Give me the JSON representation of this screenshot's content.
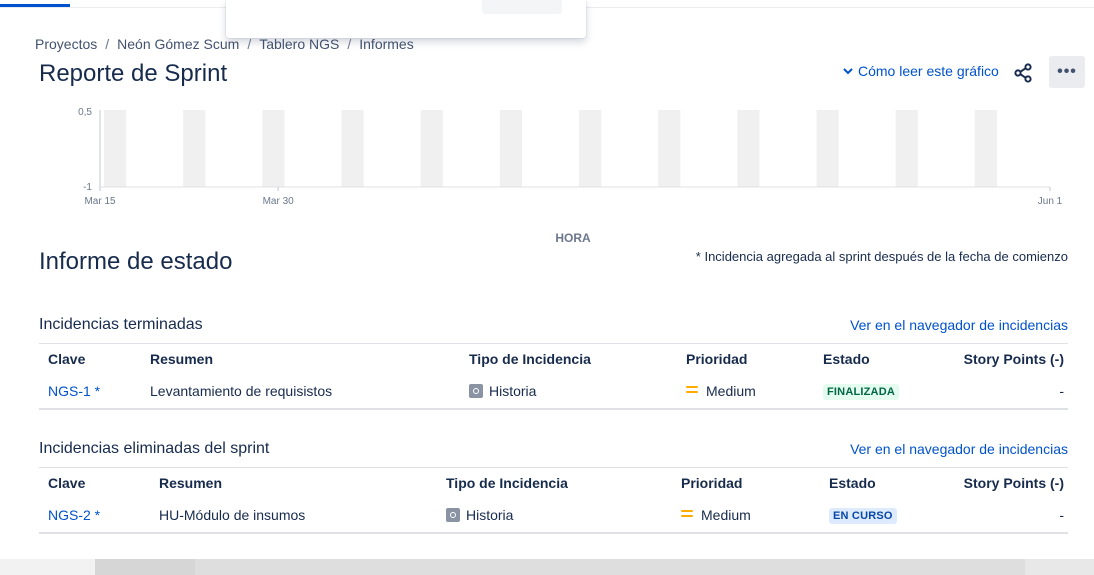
{
  "breadcrumb": [
    "Proyectos",
    "Neón Gómez Scum",
    "Tablero NGS",
    "Informes"
  ],
  "page_title": "Reporte de Sprint",
  "header_link": "Cómo leer este gráfico",
  "chart": {
    "y_top_label": "0,5",
    "y_bottom_label": "-1",
    "x_labels": [
      {
        "label": "Mar 15",
        "pos": 0
      },
      {
        "label": "Mar 30",
        "pos": 0.1875
      },
      {
        "label": "Jun 1",
        "pos": 1
      }
    ],
    "axis_title": "HORA"
  },
  "status_section": {
    "title": "Informe de estado",
    "note": "* Incidencia agregada al sprint después de la fecha de comienzo"
  },
  "completed": {
    "title": "Incidencias terminadas",
    "link": "Ver en el navegador de incidencias",
    "headers": [
      "Clave",
      "Resumen",
      "Tipo de Incidencia",
      "Prioridad",
      "Estado",
      "Story Points (-)"
    ],
    "rows": [
      {
        "key": "NGS-1 *",
        "summary": "Levantamiento de requisistos",
        "type": "Historia",
        "priority": "Medium",
        "status": "FINALIZADA",
        "points": "-"
      }
    ]
  },
  "removed": {
    "title": "Incidencias eliminadas del sprint",
    "link": "Ver en el navegador de incidencias",
    "headers": [
      "Clave",
      "Resumen",
      "Tipo de Incidencia",
      "Prioridad",
      "Estado",
      "Story Points (-)"
    ],
    "rows": [
      {
        "key": "NGS-2 *",
        "summary": "HU-Módulo de insumos",
        "type": "Historia",
        "priority": "Medium",
        "status": "EN CURSO",
        "points": "-"
      }
    ]
  }
}
